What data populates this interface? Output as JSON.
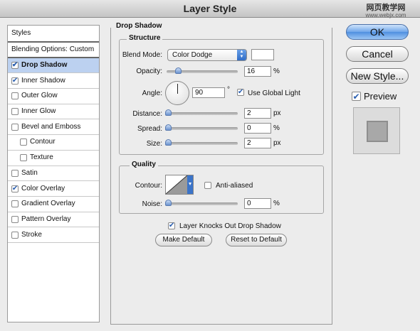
{
  "window": {
    "title": "Layer Style"
  },
  "watermark": {
    "line1": "网页教学网",
    "line2": "www.webjx.com"
  },
  "styles_panel": {
    "header": "Styles",
    "blending": "Blending Options: Custom",
    "items": [
      {
        "label": "Drop Shadow",
        "checked": "✔",
        "selected": true
      },
      {
        "label": "Inner Shadow",
        "checked": "✔"
      },
      {
        "label": "Outer Glow",
        "checked": ""
      },
      {
        "label": "Inner Glow",
        "checked": ""
      },
      {
        "label": "Bevel and Emboss",
        "checked": ""
      },
      {
        "label": "Contour",
        "checked": "",
        "sub": true
      },
      {
        "label": "Texture",
        "checked": "",
        "sub": true
      },
      {
        "label": "Satin",
        "checked": ""
      },
      {
        "label": "Color Overlay",
        "checked": "✔"
      },
      {
        "label": "Gradient Overlay",
        "checked": ""
      },
      {
        "label": "Pattern Overlay",
        "checked": ""
      },
      {
        "label": "Stroke",
        "checked": ""
      }
    ]
  },
  "drop_shadow": {
    "title": "Drop Shadow",
    "structure": {
      "title": "Structure",
      "blend_mode_label": "Blend Mode:",
      "blend_mode_value": "Color Dodge",
      "opacity_label": "Opacity:",
      "opacity_value": "16",
      "opacity_unit": "%",
      "opacity_level": 0.16,
      "angle_label": "Angle:",
      "angle_value": "90",
      "angle_unit": "°",
      "use_global_light_label": "Use Global Light",
      "use_global_light": "✔",
      "distance_label": "Distance:",
      "distance_value": "2",
      "distance_unit": "px",
      "spread_label": "Spread:",
      "spread_value": "0",
      "spread_unit": "%",
      "size_label": "Size:",
      "size_value": "2",
      "size_unit": "px"
    },
    "quality": {
      "title": "Quality",
      "contour_label": "Contour:",
      "anti_aliased_label": "Anti-aliased",
      "anti_aliased": "",
      "noise_label": "Noise:",
      "noise_value": "0",
      "noise_unit": "%"
    },
    "knockout_label": "Layer Knocks Out Drop Shadow",
    "knockout": "✔",
    "make_default": "Make Default",
    "reset_default": "Reset to Default"
  },
  "buttons": {
    "ok": "OK",
    "cancel": "Cancel",
    "new_style": "New Style...",
    "preview_label": "Preview",
    "preview_checked": "✔"
  },
  "colors": {
    "accent": "#4f8fe0",
    "selected_row": "#bcd1f0"
  }
}
